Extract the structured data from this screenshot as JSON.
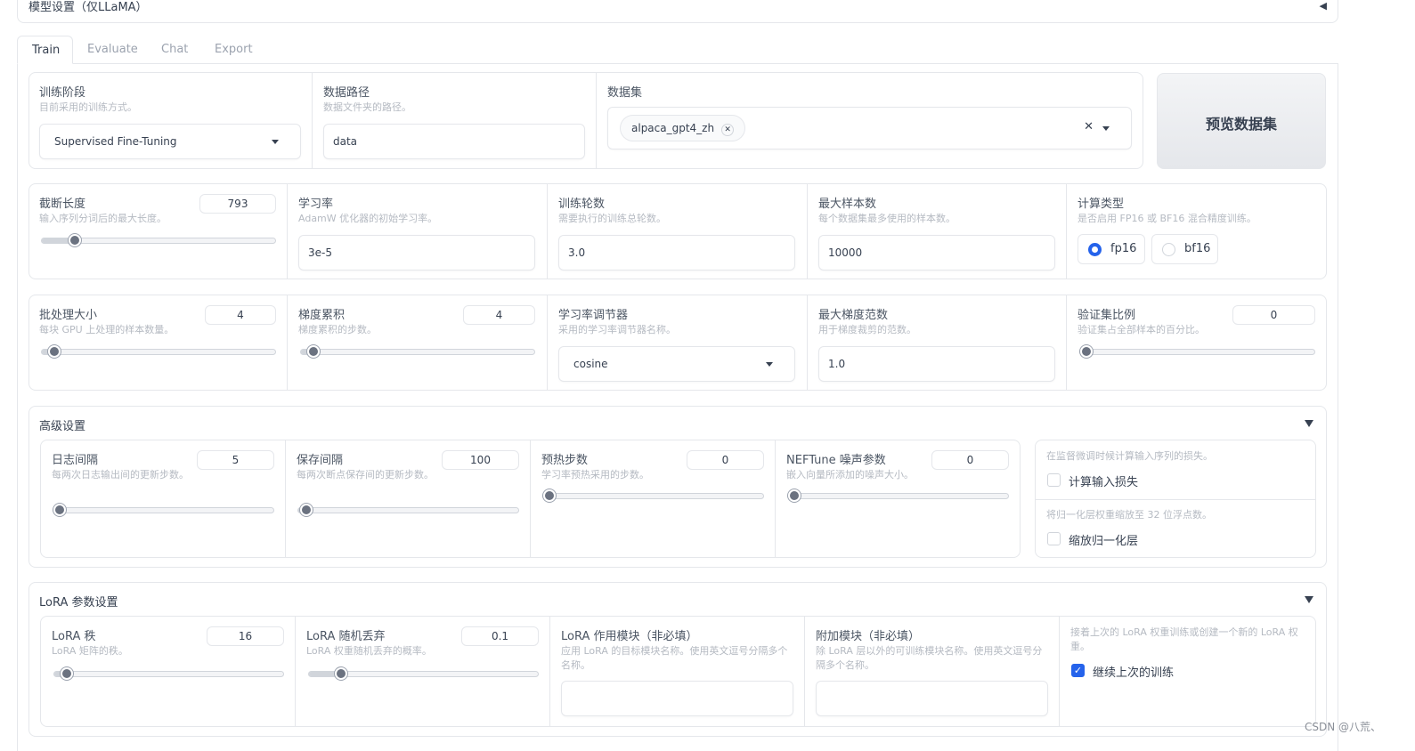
{
  "top_section": {
    "title": "模型设置（仅LLaMA）",
    "collapse_icon": "triangle-left-icon"
  },
  "tabs": [
    {
      "label": "Train",
      "active": true
    },
    {
      "label": "Evaluate",
      "active": false
    },
    {
      "label": "Chat",
      "active": false
    },
    {
      "label": "Export",
      "active": false
    }
  ],
  "row1": {
    "stage": {
      "label": "训练阶段",
      "info": "目前采用的训练方式。",
      "value": "Supervised Fine-Tuning"
    },
    "data_dir": {
      "label": "数据路径",
      "info": "数据文件夹的路径。",
      "value": "data"
    },
    "dataset": {
      "label": "数据集",
      "chips": [
        "alpaca_gpt4_zh"
      ],
      "clear_icon": "x-icon"
    },
    "preview_button": "预览数据集"
  },
  "row2": {
    "cutoff_len": {
      "label": "截断长度",
      "info": "输入序列分词后的最大长度。",
      "value": "793",
      "fraction": 0.12
    },
    "learning_rate": {
      "label": "学习率",
      "info": "AdamW 优化器的初始学习率。",
      "value": "3e-5"
    },
    "epochs": {
      "label": "训练轮数",
      "info": "需要执行的训练总轮数。",
      "value": "3.0"
    },
    "max_samples": {
      "label": "最大样本数",
      "info": "每个数据集最多使用的样本数。",
      "value": "10000"
    },
    "compute_type": {
      "label": "计算类型",
      "info": "是否启用 FP16 或 BF16 混合精度训练。",
      "options": [
        "fp16",
        "bf16"
      ],
      "selected": "fp16"
    }
  },
  "row3": {
    "batch_size": {
      "label": "批处理大小",
      "info": "每块 GPU 上处理的样本数量。",
      "value": "4",
      "fraction": 0.03
    },
    "grad_accum": {
      "label": "梯度累积",
      "info": "梯度累积的步数。",
      "value": "4",
      "fraction": 0.03
    },
    "lr_scheduler": {
      "label": "学习率调节器",
      "info": "采用的学习率调节器名称。",
      "value": "cosine"
    },
    "max_grad_norm": {
      "label": "最大梯度范数",
      "info": "用于梯度裁剪的范数。",
      "value": "1.0"
    },
    "val_size": {
      "label": "验证集比例",
      "info": "验证集占全部样本的百分比。",
      "value": "0",
      "fraction": 0.0
    }
  },
  "advanced": {
    "title": "高级设置",
    "logging_steps": {
      "label": "日志间隔",
      "info": "每两次日志输出间的更新步数。",
      "value": "5",
      "fraction": 0.0
    },
    "save_steps": {
      "label": "保存间隔",
      "info": "每两次断点保存间的更新步数。",
      "value": "100",
      "fraction": 0.01
    },
    "warmup_steps": {
      "label": "预热步数",
      "info": "学习率预热采用的步数。",
      "value": "0",
      "fraction": 0.0
    },
    "neftune": {
      "label": "NEFTune 噪声参数",
      "info": "嵌入向量所添加的噪声大小。",
      "value": "0",
      "fraction": 0.0
    },
    "train_on_prompt": {
      "info": "在监督微调时候计算输入序列的损失。",
      "label": "计算输入损失",
      "checked": false
    },
    "upcast_layernorm": {
      "info": "将归一化层权重缩放至 32 位浮点数。",
      "label": "缩放归一化层",
      "checked": false
    }
  },
  "lora": {
    "title": "LoRA 参数设置",
    "rank": {
      "label": "LoRA 秩",
      "info": "LoRA 矩阵的秩。",
      "value": "16",
      "fraction": 0.03
    },
    "dropout": {
      "label": "LoRA 随机丢弃",
      "info": "LoRA 权重随机丢弃的概率。",
      "value": "0.1",
      "fraction": 0.12
    },
    "target": {
      "label": "LoRA 作用模块（非必填）",
      "info": "应用 LoRA 的目标模块名称。使用英文逗号分隔多个名称。",
      "value": ""
    },
    "additional_target": {
      "label": "附加模块（非必填）",
      "info": "除 LoRA 层以外的可训练模块名称。使用英文逗号分隔多个名称。",
      "value": ""
    },
    "resume": {
      "info": "接着上次的 LoRA 权重训练或创建一个新的 LoRA 权重。",
      "label": "继续上次的训练",
      "checked": true
    }
  },
  "watermark": "CSDN @八荒、"
}
